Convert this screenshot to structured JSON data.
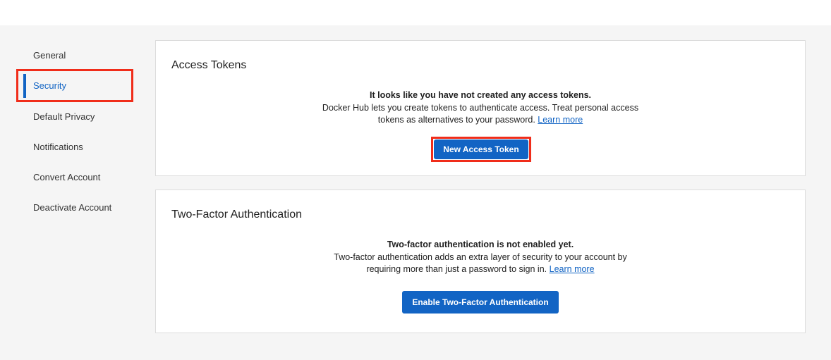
{
  "sidebar": {
    "items": [
      {
        "label": "General"
      },
      {
        "label": "Security",
        "active": true
      },
      {
        "label": "Default Privacy"
      },
      {
        "label": "Notifications"
      },
      {
        "label": "Convert Account"
      },
      {
        "label": "Deactivate Account"
      }
    ]
  },
  "access_tokens": {
    "title": "Access Tokens",
    "heading": "It looks like you have not created any access tokens.",
    "description_line1": "Docker Hub lets you create tokens to authenticate access. Treat personal access",
    "description_line2": "tokens as alternatives to your password.",
    "learn_more": "Learn more",
    "button_label": "New Access Token"
  },
  "two_factor": {
    "title": "Two-Factor Authentication",
    "heading": "Two-factor authentication is not enabled yet.",
    "description_line1": "Two-factor authentication adds an extra layer of security to your account by",
    "description_line2": "requiring more than just a password to sign in.",
    "learn_more": "Learn more",
    "button_label": "Enable Two-Factor Authentication"
  },
  "colors": {
    "accent": "#1264c4",
    "highlight": "#f02d1a",
    "page_background": "#f5f5f5"
  }
}
